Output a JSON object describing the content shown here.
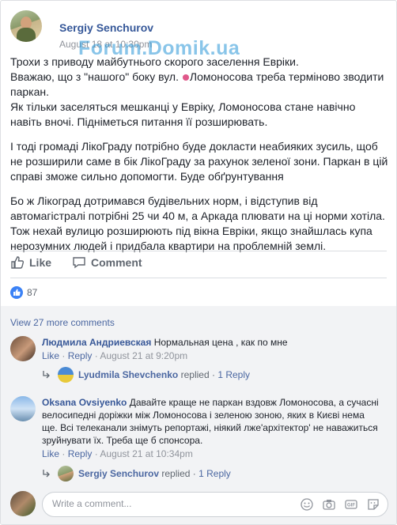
{
  "post": {
    "author": "Sergiy Senchurov",
    "time": "August 18 at 10:30pm",
    "watermark": "Forum.Domik.ua",
    "paragraphs": [
      "Трохи з приводу майбутнього скорого заселення Еврiки.",
      "Вважаю, що з \"нашого\" боку вул.",
      "Ломоносова треба терміново зводити паркан.",
      "Як тільки заселяться мешканці у Еврiку, Ломоносова стане навічно навіть вночі. Підніметься питання її розширювать.",
      "І тоді громаді ЛікоГраду потрібно буде докласти неабияких зусиль, щоб не розширили саме в бік ЛікоГраду за рахунок зеленої зони. Паркан в цій справі зможе сильно допомогти. Буде обґрунтування",
      "Бо ж Лікоград дотримався будівельних норм, і відступив від автомагістралі потрібні 25 чи 40 м, а Аркада плювати на ці норми хотіла. Тож нехай вулицю розширюють під вікна Еврiки, якщо знайшлась купа нерозумних людей і придбала квартири на проблемній землі."
    ],
    "like_label": "Like",
    "comment_label": "Comment",
    "reactions_count": "87"
  },
  "comments": {
    "view_more": "View 27 more comments",
    "items": [
      {
        "author": "Людмила Андриевская",
        "text": "Нормальная цена , как по мне",
        "like": "Like",
        "reply": "Reply",
        "time": "August 21 at 9:20pm",
        "replied_by": "Lyudmila Shevchenko",
        "replied_text": "replied",
        "replies": "1 Reply"
      },
      {
        "author": "Oksana Ovsiyenko",
        "text": "Давайте краще не паркан вздовж Ломоносова, а сучасні велосипедні доріжки між Ломоносова і зеленою зоною, яких в Києві нема ще. Всі телеканали знімуть репортажі, ніякий лже'архітектор' не наважиться зруйнувати їх. Треба ще б спонсора.",
        "like": "Like",
        "reply": "Reply",
        "time": "August 21 at 10:34pm",
        "replied_by": "Sergiy Senchurov",
        "replied_text": "replied",
        "replies": "1 Reply"
      }
    ],
    "separator": "·",
    "write_placeholder": "Write a comment..."
  },
  "icons": [
    "like-icon",
    "comment-icon",
    "reaction-like-icon",
    "reply-arrow-icon",
    "emoji-icon",
    "camera-icon",
    "gif-icon",
    "sticker-icon"
  ],
  "colors": {
    "link": "#365899",
    "meta": "#90949c",
    "accent": "#3b82f6"
  }
}
